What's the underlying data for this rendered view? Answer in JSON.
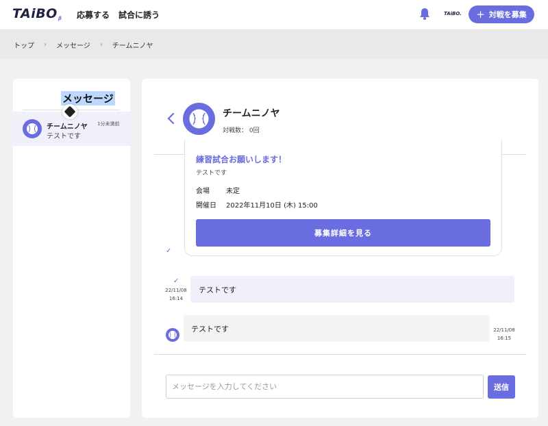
{
  "header": {
    "logo": "TAiBO",
    "logo_sub": "β",
    "nav": [
      "応募する",
      "試合に誘う"
    ],
    "mini_logo": "TAiBO.",
    "cta_label": "対戦を募集",
    "cta_icon": "plus-icon"
  },
  "breadcrumb": [
    "トップ",
    "メッセージ",
    "チームニノヤ"
  ],
  "sidebar": {
    "title": "メッセージ",
    "conversations": [
      {
        "name": "チームニノヤ",
        "time": "1分未満前",
        "snippet": "テストです"
      }
    ]
  },
  "chat": {
    "team_name": "チームニノヤ",
    "stats": "対戦数： 0回",
    "card": {
      "title": "練習試合お願いします！",
      "subtitle": "テストです",
      "venue_label": "会場",
      "venue_value": "未定",
      "date_label": "開催日",
      "date_value": "2022年11月10日 (木) 15:00",
      "button": "募集詳細を見る"
    },
    "messages": [
      {
        "direction": "out",
        "text": "テストです",
        "date": "22/11/08",
        "time": "16:14"
      },
      {
        "direction": "in",
        "text": "テストです",
        "date": "22/11/08",
        "time": "16:15"
      }
    ],
    "input_placeholder": "メッセージを入力してください",
    "input_value": "",
    "send_label": "送信"
  },
  "colors": {
    "accent": "#6a6ddf",
    "background": "#f1f1f3",
    "bubble_out": "#f0f0fb",
    "bubble_in": "#f3f3f4"
  }
}
